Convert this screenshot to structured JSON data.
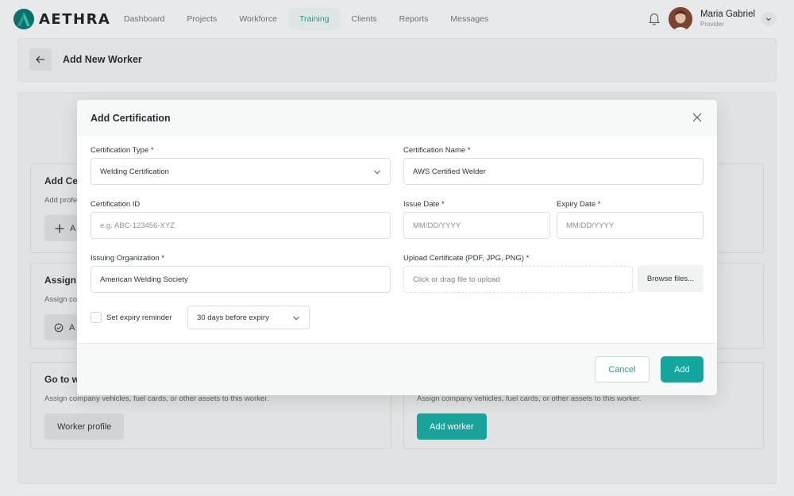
{
  "brand": {
    "name": "AETHRA",
    "accent": "#14a69e",
    "logo_bg": "#0d6e6b"
  },
  "nav": {
    "items": [
      {
        "label": "Dashboard",
        "active": false
      },
      {
        "label": "Projects",
        "active": false
      },
      {
        "label": "Workforce",
        "active": false
      },
      {
        "label": "Training",
        "active": true
      },
      {
        "label": "Clients",
        "active": false
      },
      {
        "label": "Reports",
        "active": false
      },
      {
        "label": "Messages",
        "active": false
      }
    ]
  },
  "user": {
    "name": "Maria Gabriel",
    "role": "Provider",
    "notification_icon": "bell-icon",
    "menu_icon": "chevron-down-icon"
  },
  "page": {
    "title": "Add New Worker",
    "back_icon": "arrow-left-icon"
  },
  "background_panels": [
    {
      "title": "Add Ce",
      "desc": "Add profe",
      "button": "A",
      "button_icon": "plus-icon"
    },
    {
      "title": "Assign",
      "desc": "Assign co",
      "button": "A",
      "button_icon": "check-circle-icon"
    },
    {
      "title": "Go to w",
      "desc": "Assign company vehicles, fuel cards, or other assets to this worker.",
      "button": "Worker profile"
    },
    {
      "desc": "Assign company vehicles, fuel cards, or other assets to this worker.",
      "button": "Add worker"
    }
  ],
  "modal": {
    "title": "Add Certification",
    "close_icon": "close-icon",
    "cert_type": {
      "label": "Certification Type *",
      "value": "Welding Certification"
    },
    "cert_name": {
      "label": "Certification Name *",
      "value": "AWS Certified Welder"
    },
    "cert_id": {
      "label": "Certification ID",
      "placeholder": "e.g. ABC-123456-XYZ"
    },
    "issue_date": {
      "label": "Issue Date *",
      "placeholder": "MM/DD/YYYY"
    },
    "expiry_date": {
      "label": "Expiry Date *",
      "placeholder": "MM/DD/YYYY"
    },
    "issuing_org": {
      "label": "Issuing Organization *",
      "value": "American Welding Society"
    },
    "upload": {
      "label": "Upload Certificate (PDF, JPG, PNG) *",
      "placeholder": "Click or drag file to upload",
      "browse_label": "Browse files..."
    },
    "reminder": {
      "label": "Set expiry reminder",
      "checked": false,
      "option": "30 days before expiry"
    },
    "cancel_label": "Cancel",
    "add_label": "Add"
  }
}
